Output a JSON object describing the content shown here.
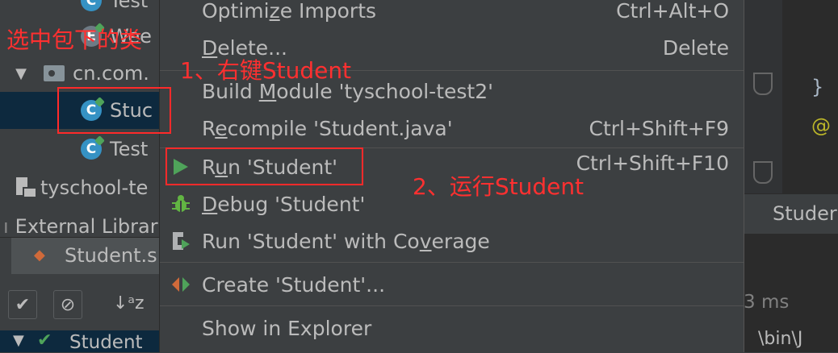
{
  "colors": {
    "accent_red": "#ff2a2a",
    "run_green": "#4fa35a",
    "selection": "#0d293e"
  },
  "tree": {
    "row_test_top": "Test",
    "row_wee": "Wee",
    "row_package": "cn.com.",
    "row_student": "Stuc",
    "row_test": "Test",
    "row_module": "tyschool-te",
    "row_external": "External Librar"
  },
  "annotations": {
    "select_class": "选中包下的类",
    "step1": "1、右键Student",
    "step2": "2、运行Student"
  },
  "menu": {
    "items": [
      {
        "label_pre": "Optimi",
        "label_u": "z",
        "label_post": "e Imports",
        "shortcut": "Ctrl+Alt+O",
        "icon": ""
      },
      {
        "label_pre": "",
        "label_u": "D",
        "label_post": "elete...",
        "shortcut": "Delete",
        "icon": ""
      },
      {
        "label_pre": "Build ",
        "label_u": "M",
        "label_post": "odule 'tyschool-test2'",
        "shortcut": "",
        "icon": ""
      },
      {
        "label_pre": "R",
        "label_u": "e",
        "label_post": "compile 'Student.java'",
        "shortcut": "Ctrl+Shift+F9",
        "icon": ""
      },
      {
        "label_pre": "R",
        "label_u": "u",
        "label_post": "n 'Student'",
        "shortcut": "Ctrl+Shift+F10",
        "icon": "run-icon"
      },
      {
        "label_pre": "",
        "label_u": "D",
        "label_post": "ebug 'Student'",
        "shortcut": "",
        "icon": "debug-icon"
      },
      {
        "label_pre": "Run 'Student' with Co",
        "label_u": "v",
        "label_post": "erage",
        "shortcut": "",
        "icon": "coverage-icon"
      },
      {
        "label_pre": "Create 'Student'...",
        "label_u": "",
        "label_post": "",
        "shortcut": "",
        "icon": "create-config-icon"
      },
      {
        "label_pre": "Show in Explorer",
        "label_u": "",
        "label_post": "",
        "shortcut": "",
        "icon": ""
      }
    ]
  },
  "bottom": {
    "tab_label": "Student.s",
    "result_label": "Student",
    "sort_icon_text": "↓ᵃz"
  },
  "right": {
    "tab_label": "Studer",
    "time_text": "3 ms",
    "path_text": "\\bin\\J"
  }
}
